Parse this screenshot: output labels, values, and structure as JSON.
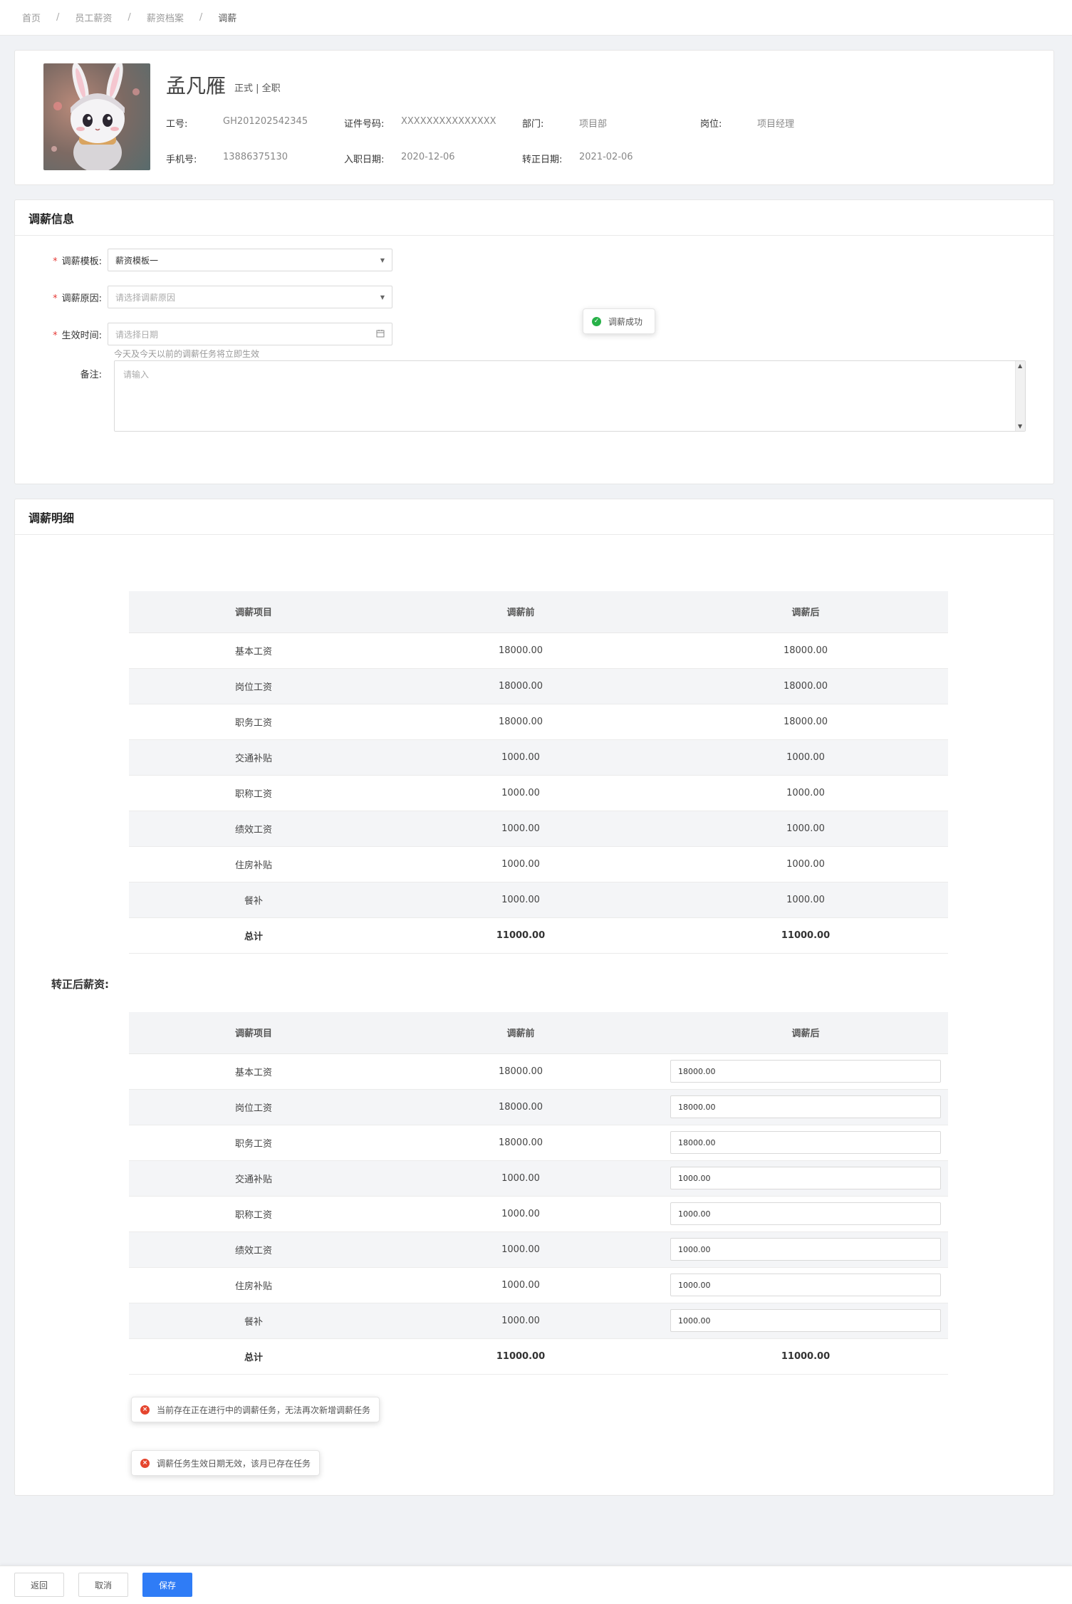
{
  "breadcrumb": {
    "items": [
      "首页",
      "员工薪资",
      "薪资档案"
    ],
    "current": "调薪",
    "separator": "/"
  },
  "employee": {
    "name": "孟凡雁",
    "tags": "正式 | 全职",
    "fields": [
      {
        "label": "工号:",
        "value": "GH201202542345"
      },
      {
        "label": "证件号码:",
        "value": "XXXXXXXXXXXXXXX"
      },
      {
        "label": "部门:",
        "value": "项目部"
      },
      {
        "label": "岗位:",
        "value": "项目经理"
      },
      {
        "label": "手机号:",
        "value": "13886375130"
      },
      {
        "label": "入职日期:",
        "value": "2020-12-06"
      },
      {
        "label": "转正日期:",
        "value": "2021-02-06"
      }
    ]
  },
  "salary_info": {
    "title": "调薪信息",
    "template": {
      "label": "调薪模板:",
      "value": "薪资模板一"
    },
    "reason": {
      "label": "调薪原因:",
      "placeholder": "请选择调薪原因"
    },
    "effective": {
      "label": "生效时间:",
      "placeholder": "请选择日期",
      "hint": "今天及今天以前的调薪任务将立即生效"
    },
    "remark": {
      "label": "备注:",
      "placeholder": "请输入"
    }
  },
  "toasts": {
    "success": "调薪成功",
    "error1": "当前存在正在进行中的调薪任务，无法再次新增调薪任务",
    "error2": "调薪任务生效日期无效，该月已存在任务"
  },
  "detail": {
    "title": "调薪明细",
    "columns": [
      "调薪项目",
      "调薪前",
      "调薪后"
    ],
    "rows": [
      {
        "item": "基本工资",
        "before": "18000.00",
        "after": "18000.00"
      },
      {
        "item": "岗位工资",
        "before": "18000.00",
        "after": "18000.00"
      },
      {
        "item": "职务工资",
        "before": "18000.00",
        "after": "18000.00"
      },
      {
        "item": "交通补贴",
        "before": "1000.00",
        "after": "1000.00"
      },
      {
        "item": "职称工资",
        "before": "1000.00",
        "after": "1000.00"
      },
      {
        "item": "绩效工资",
        "before": "1000.00",
        "after": "1000.00"
      },
      {
        "item": "住房补贴",
        "before": "1000.00",
        "after": "1000.00"
      },
      {
        "item": "餐补",
        "before": "1000.00",
        "after": "1000.00"
      }
    ],
    "total": {
      "item": "总计",
      "before": "11000.00",
      "after": "11000.00"
    },
    "after_probation_label": "转正后薪资:",
    "rows2": [
      {
        "item": "基本工资",
        "before": "18000.00",
        "after": "18000.00"
      },
      {
        "item": "岗位工资",
        "before": "18000.00",
        "after": "18000.00"
      },
      {
        "item": "职务工资",
        "before": "18000.00",
        "after": "18000.00"
      },
      {
        "item": "交通补贴",
        "before": "1000.00",
        "after": "1000.00"
      },
      {
        "item": "职称工资",
        "before": "1000.00",
        "after": "1000.00"
      },
      {
        "item": "绩效工资",
        "before": "1000.00",
        "after": "1000.00"
      },
      {
        "item": "住房补贴",
        "before": "1000.00",
        "after": "1000.00"
      },
      {
        "item": "餐补",
        "before": "1000.00",
        "after": "1000.00"
      }
    ],
    "total2": {
      "item": "总计",
      "before": "11000.00",
      "after": "11000.00"
    }
  },
  "footer": {
    "back": "返回",
    "cancel": "取消",
    "save": "保存"
  },
  "colors": {
    "primary": "#2f7cf6",
    "success": "#27b148",
    "error": "#e5452e",
    "required": "#e53935"
  }
}
